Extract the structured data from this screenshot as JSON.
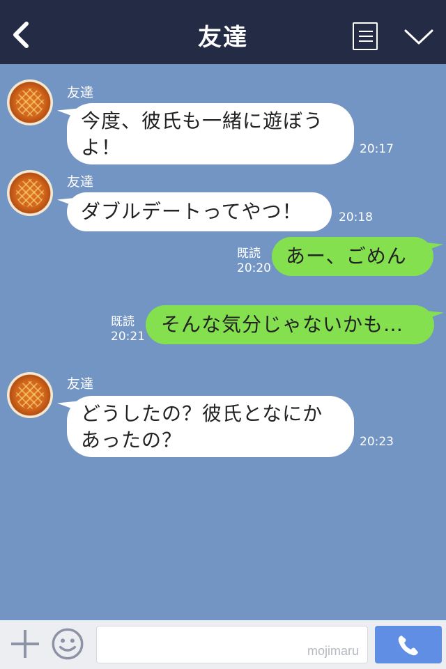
{
  "header": {
    "title": "友達",
    "back_icon": "back-chevron-icon",
    "menu_icon": "menu-note-icon",
    "dropdown_icon": "chevron-down-icon"
  },
  "messages": [
    {
      "direction": "in",
      "sender": "友達",
      "text_lines": [
        "今度、彼氏も一緒に遊ぼう",
        "よ！"
      ],
      "time": "20:17"
    },
    {
      "direction": "in",
      "sender": "友達",
      "text_lines": [
        "ダブルデートってやつ！"
      ],
      "time": "20:18"
    },
    {
      "direction": "out",
      "read": "既読",
      "text_lines": [
        "あー、ごめん"
      ],
      "time": "20:20"
    },
    {
      "direction": "out",
      "read": "既読",
      "text_lines": [
        "そんな気分じゃないかも…"
      ],
      "time": "20:21"
    },
    {
      "direction": "in",
      "sender": "友達",
      "text_lines": [
        "どうしたの？彼氏となにか",
        "あったの？"
      ],
      "time": "20:23"
    }
  ],
  "composer": {
    "value": "",
    "watermark": "mojimaru",
    "plus_icon": "plus-icon",
    "sticker_icon": "smiley-icon",
    "call_icon": "phone-icon"
  },
  "colors": {
    "header_bg": "#232c44",
    "chat_bg": "#7395c4",
    "incoming_bubble": "#ffffff",
    "outgoing_bubble": "#84e04e",
    "call_button": "#5f8ee4"
  }
}
